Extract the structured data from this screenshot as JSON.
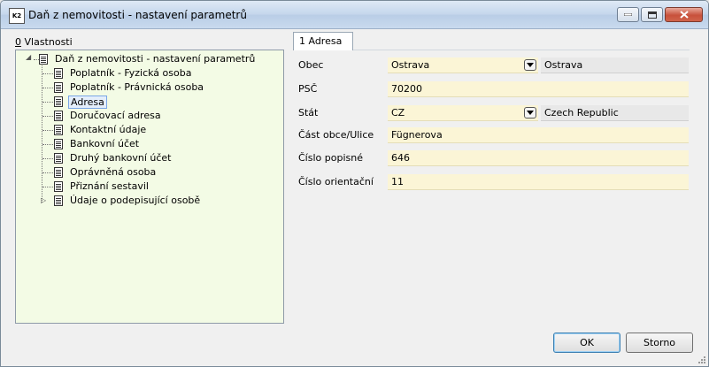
{
  "window": {
    "icon_text": "K2",
    "title": "Daň z nemovitosti - nastavení parametrů"
  },
  "properties": {
    "label_prefix": "0",
    "label_rest": " Vlastnosti"
  },
  "tree": {
    "root": "Daň z nemovitosti - nastavení parametrů",
    "items": [
      {
        "label": "Poplatník - Fyzická osoba"
      },
      {
        "label": "Poplatník - Právnická osoba"
      },
      {
        "label": "Adresa",
        "selected": true
      },
      {
        "label": "Doručovací adresa"
      },
      {
        "label": "Kontaktní údaje"
      },
      {
        "label": "Bankovní účet"
      },
      {
        "label": "Druhý bankovní účet"
      },
      {
        "label": "Oprávněná osoba"
      },
      {
        "label": "Přiznání sestavil"
      },
      {
        "label": "Údaje o podepisující osobě",
        "expandable": true
      }
    ]
  },
  "tab": {
    "label": "1 Adresa"
  },
  "form": {
    "obec": {
      "label": "Obec",
      "value": "Ostrava",
      "display": "Ostrava"
    },
    "psc": {
      "label": "PSČ",
      "value": "70200"
    },
    "stat": {
      "label": "Stát",
      "value": "CZ",
      "display": "Czech Republic"
    },
    "cast": {
      "label": "Část obce/Ulice",
      "value": "Fügnerova"
    },
    "popisne": {
      "label": "Číslo popisné",
      "value": "646"
    },
    "orientacni": {
      "label": "Číslo orientační",
      "value": "11"
    }
  },
  "buttons": {
    "ok": "OK",
    "cancel": "Storno"
  },
  "colors": {
    "tree_bg": "#f3fbe5",
    "field_bg": "#fbf5d6",
    "selection_border": "#7aa6e6"
  }
}
